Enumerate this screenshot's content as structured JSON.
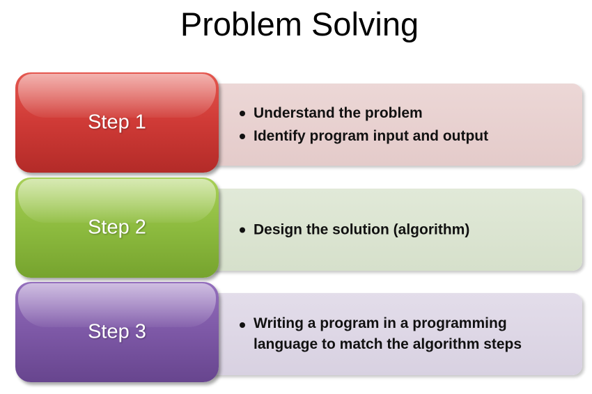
{
  "title": "Problem Solving",
  "colors": {
    "step1": "#cf3a36",
    "step2": "#8dbb3f",
    "step3": "#7d58a6",
    "panel1": "#e8d0cf",
    "panel2": "#dbe5d1",
    "panel3": "#ddd7e5"
  },
  "steps": [
    {
      "label": "Step 1",
      "bullets": [
        "Understand the problem",
        "Identify program input and output"
      ]
    },
    {
      "label": "Step 2",
      "bullets": [
        "Design the solution (algorithm)"
      ]
    },
    {
      "label": "Step 3",
      "bullets": [
        "Writing a program in a programming language to match the algorithm steps"
      ]
    }
  ]
}
